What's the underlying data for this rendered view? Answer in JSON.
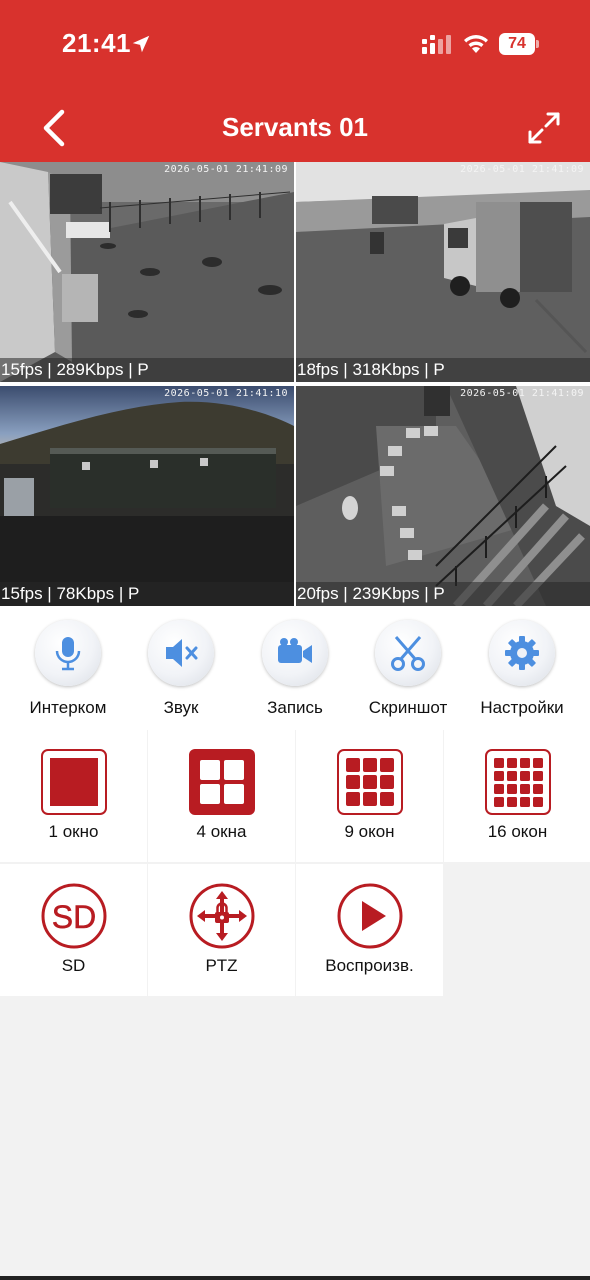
{
  "status_bar": {
    "time": "21:41",
    "battery": "74"
  },
  "header": {
    "title": "Servants 01"
  },
  "cameras": [
    {
      "timestamp": "2026-05-01 21:41:09",
      "stats": "15fps | 289Kbps | P"
    },
    {
      "timestamp": "2026-05-01 21:41:09",
      "stats": "18fps | 318Kbps | P"
    },
    {
      "timestamp": "2026-05-01 21:41:10",
      "stats": "15fps | 78Kbps | P"
    },
    {
      "timestamp": "2026-05-01 21:41:09",
      "stats": "20fps | 239Kbps | P"
    }
  ],
  "actions": [
    {
      "label": "Интерком",
      "icon": "microphone-icon"
    },
    {
      "label": "Звук",
      "icon": "speaker-muted-icon"
    },
    {
      "label": "Запись",
      "icon": "video-camera-icon"
    },
    {
      "label": "Скриншот",
      "icon": "scissors-icon"
    },
    {
      "label": "Настройки",
      "icon": "gear-icon"
    }
  ],
  "layouts": [
    {
      "label": "1 окно",
      "icon": "grid-1-icon"
    },
    {
      "label": "4 окна",
      "icon": "grid-4-icon"
    },
    {
      "label": "9 окон",
      "icon": "grid-9-icon"
    },
    {
      "label": "16 окон",
      "icon": "grid-16-icon"
    }
  ],
  "features": [
    {
      "label": "SD",
      "icon": "sd-card-icon"
    },
    {
      "label": "PTZ",
      "icon": "ptz-icon"
    },
    {
      "label": "Воспроизв.",
      "icon": "play-icon"
    }
  ],
  "colors": {
    "brand_red": "#d8322d",
    "icon_red": "#b81c22",
    "icon_blue": "#4d8fe0",
    "selected_border": "#e6c15a"
  }
}
